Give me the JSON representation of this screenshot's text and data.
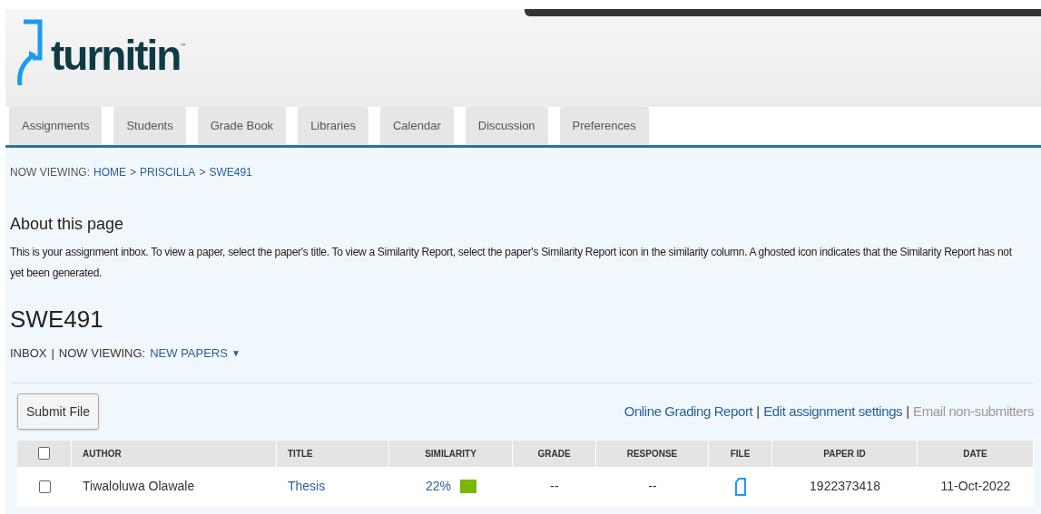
{
  "logo": {
    "wordmark": "turnitin",
    "trademark": "™"
  },
  "tabs": [
    {
      "label": "Assignments",
      "selected": false
    },
    {
      "label": "Students",
      "selected": false
    },
    {
      "label": "Grade Book",
      "selected": false
    },
    {
      "label": "Libraries",
      "selected": false
    },
    {
      "label": "Calendar",
      "selected": false
    },
    {
      "label": "Discussion",
      "selected": false
    },
    {
      "label": "Preferences",
      "selected": false
    }
  ],
  "breadcrumb": {
    "prefix": "NOW VIEWING:",
    "items": [
      "HOME",
      "PRISCILLA",
      "SWE491"
    ],
    "separator": ">"
  },
  "about": {
    "title": "About this page",
    "text": "This is your assignment inbox. To view a paper, select the paper's title. To view a Similarity Report, select the paper's Similarity Report icon in the similarity column. A ghosted icon indicates that the Similarity Report has not yet been generated."
  },
  "class_title": "SWE491",
  "inbox": {
    "label": "INBOX",
    "separator": "|",
    "viewing": "NOW VIEWING:",
    "filter": "NEW PAPERS",
    "caret": "▼"
  },
  "toolbar": {
    "submit": "Submit File",
    "links": [
      {
        "label": "Online Grading Report",
        "disabled": false
      },
      {
        "label": "Edit assignment settings",
        "disabled": false
      },
      {
        "label": "Email non-submitters",
        "disabled": true
      }
    ],
    "separator": "|"
  },
  "table": {
    "select_all_checked": false,
    "columns": [
      "AUTHOR",
      "TITLE",
      "SIMILARITY",
      "GRADE",
      "RESPONSE",
      "FILE",
      "PAPER ID",
      "DATE"
    ],
    "rows": [
      {
        "checked": false,
        "author": "Tiwaloluwa Olawale",
        "title": "Thesis",
        "similarity": "22%",
        "color": "#7ab800",
        "grade": "--",
        "response": "--",
        "paper_id": "1922373418",
        "date": "11-Oct-2022"
      }
    ]
  }
}
